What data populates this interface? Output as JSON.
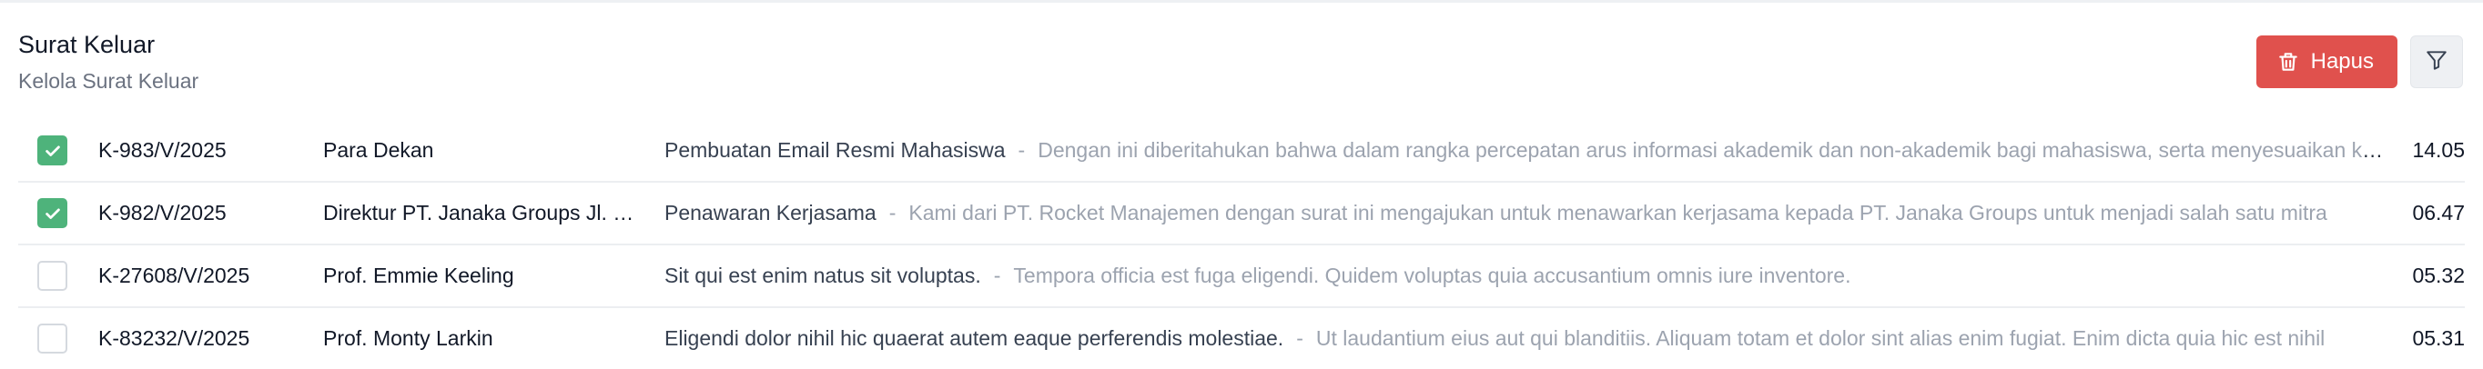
{
  "header": {
    "title": "Surat Keluar",
    "subtitle": "Kelola Surat Keluar"
  },
  "actions": {
    "delete_label": "Hapus",
    "delete_color": "#e0514d",
    "filter_icon": "filter-icon",
    "delete_icon": "trash-icon"
  },
  "colors": {
    "checked": "#4eb37b"
  },
  "rows": [
    {
      "checked": true,
      "number": "K-983/V/2025",
      "recipient": "Para Dekan",
      "subject": "Pembuatan Email Resmi Mahasiswa",
      "separator": "-",
      "excerpt": "Dengan ini diberitahukan bahwa dalam rangka percepatan arus informasi akademik dan non-akademik bagi mahasiswa, serta menyesuaikan kebutuhan komunikasi resmi",
      "time": "14.05"
    },
    {
      "checked": true,
      "number": "K-982/V/2025",
      "recipient": "Direktur PT. Janaka Groups Jl. Merdeka",
      "subject": "Penawaran Kerjasama",
      "separator": "-",
      "excerpt": "Kami dari PT. Rocket Manajemen dengan surat ini mengajukan untuk menawarkan kerjasama kepada PT. Janaka Groups untuk menjadi salah satu mitra",
      "time": "06.47"
    },
    {
      "checked": false,
      "number": "K-27608/V/2025",
      "recipient": "Prof. Emmie Keeling",
      "subject": "Sit qui est enim natus sit voluptas.",
      "separator": "-",
      "excerpt": "Tempora officia est fuga eligendi. Quidem voluptas quia accusantium omnis iure inventore.",
      "time": "05.32"
    },
    {
      "checked": false,
      "number": "K-83232/V/2025",
      "recipient": "Prof. Monty Larkin",
      "subject": "Eligendi dolor nihil hic quaerat autem eaque perferendis molestiae.",
      "separator": "-",
      "excerpt": "Ut laudantium eius aut qui blanditiis. Aliquam totam et dolor sint alias enim fugiat. Enim dicta quia hic est nihil",
      "time": "05.31"
    }
  ]
}
